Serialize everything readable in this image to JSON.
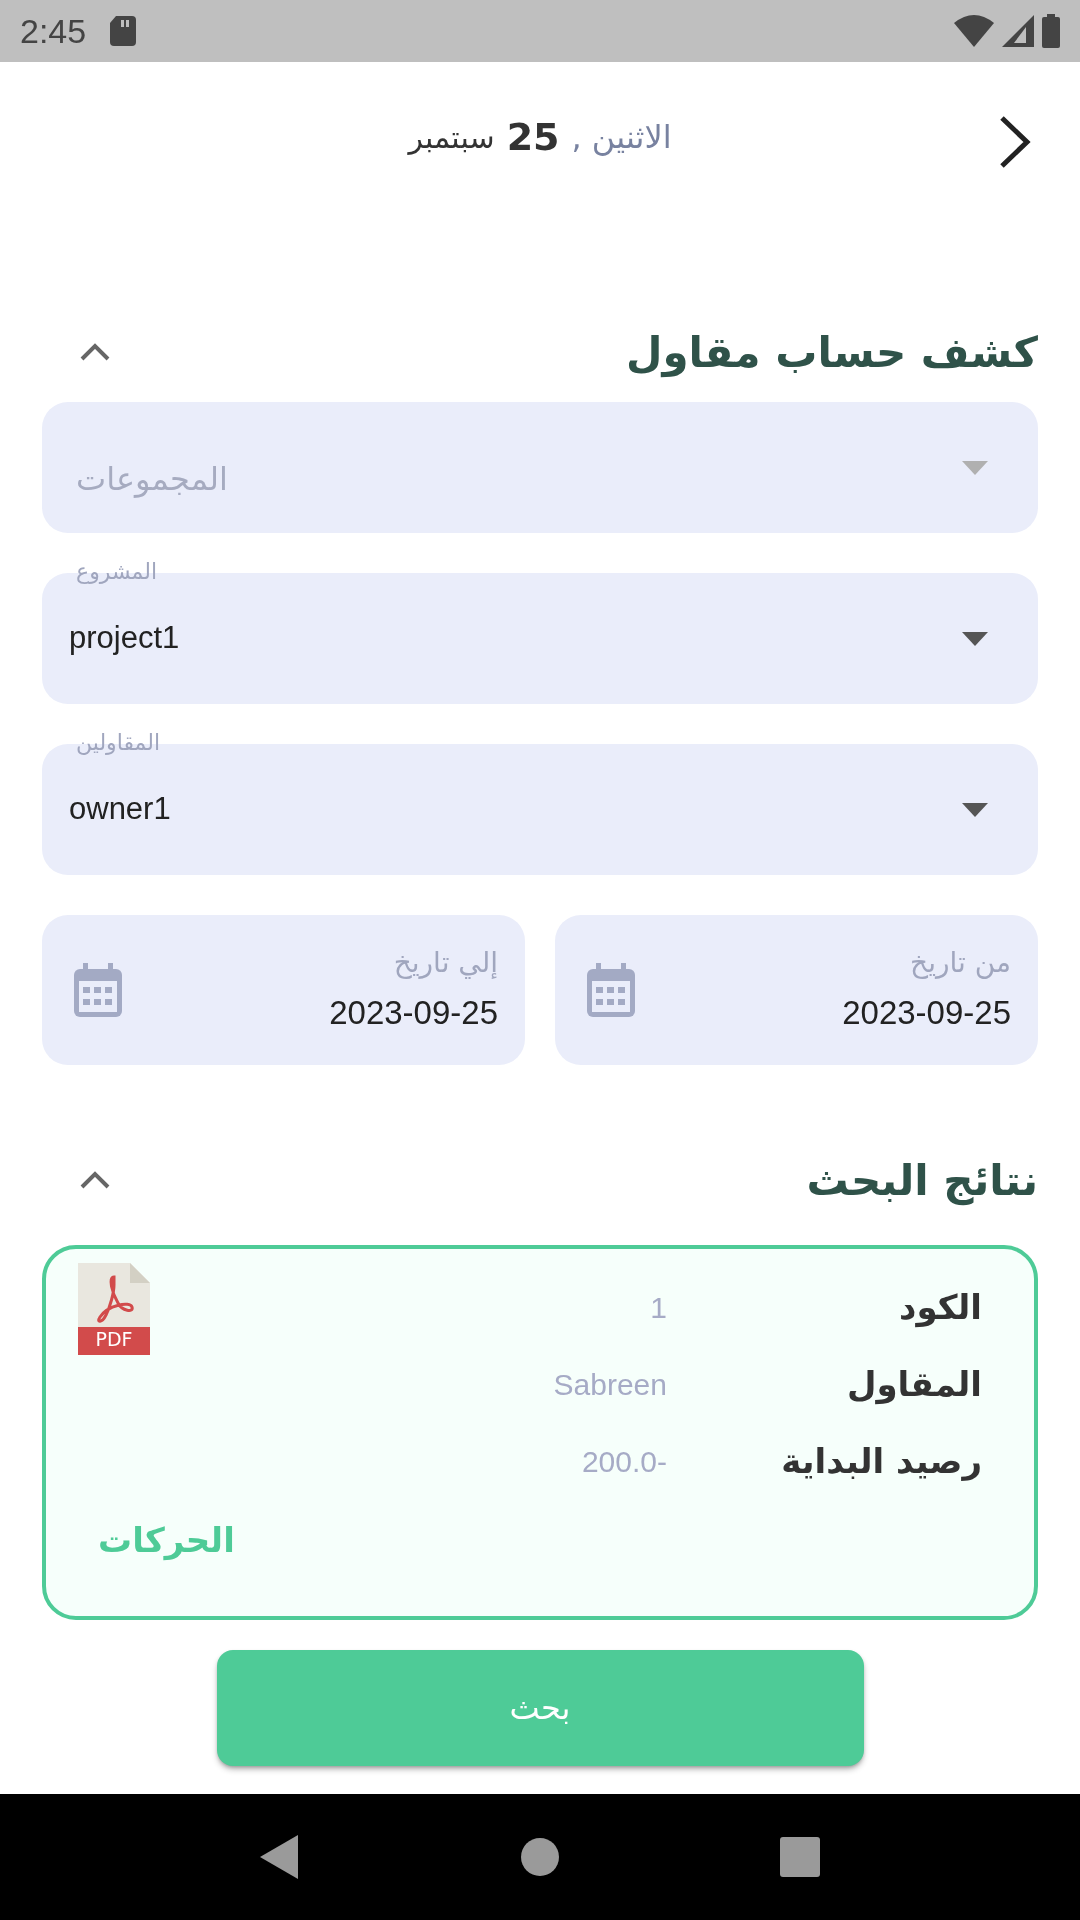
{
  "status_bar": {
    "time": "2:45"
  },
  "header": {
    "weekday": "الاثنين ,",
    "day": "25",
    "month": "سبتمبر"
  },
  "filter_section": {
    "title": "كشف حساب مقاول",
    "expanded": true,
    "dropdowns": [
      {
        "placeholder": "المجموعات"
      },
      {
        "label": "المشروع",
        "value": "project1"
      },
      {
        "label": "المقاولين",
        "value": "owner1"
      }
    ],
    "date_fields": [
      {
        "label": "من تاريخ",
        "value": "2023-09-25"
      },
      {
        "label": "إلي تاريخ",
        "value": "2023-09-25"
      }
    ]
  },
  "results_section": {
    "title": "نتائج البحث",
    "expanded": true,
    "cards": [
      {
        "rows": [
          {
            "label": "الكود",
            "value": "1"
          },
          {
            "label": "المقاول",
            "value": "Sabreen"
          },
          {
            "label": "رصيد البداية",
            "value": "200.0-"
          }
        ],
        "pdf_label": "PDF",
        "link": "الحركات"
      }
    ]
  },
  "search_button": "بحث"
}
